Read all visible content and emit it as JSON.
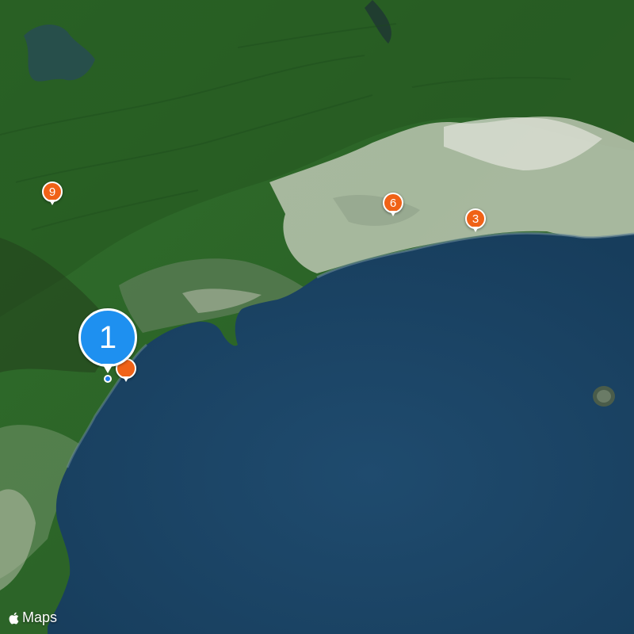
{
  "map": {
    "type": "satellite",
    "attribution": "Maps",
    "pin_color": "#f06217",
    "cluster_color": "#1e90f0",
    "markers": [
      {
        "id": "cluster-1",
        "label": "1",
        "kind": "cluster"
      },
      {
        "id": "marker-2",
        "label": "",
        "kind": "pin"
      },
      {
        "id": "marker-3",
        "label": "3",
        "kind": "pin"
      },
      {
        "id": "marker-6",
        "label": "6",
        "kind": "pin"
      },
      {
        "id": "marker-9",
        "label": "9",
        "kind": "pin"
      }
    ]
  }
}
